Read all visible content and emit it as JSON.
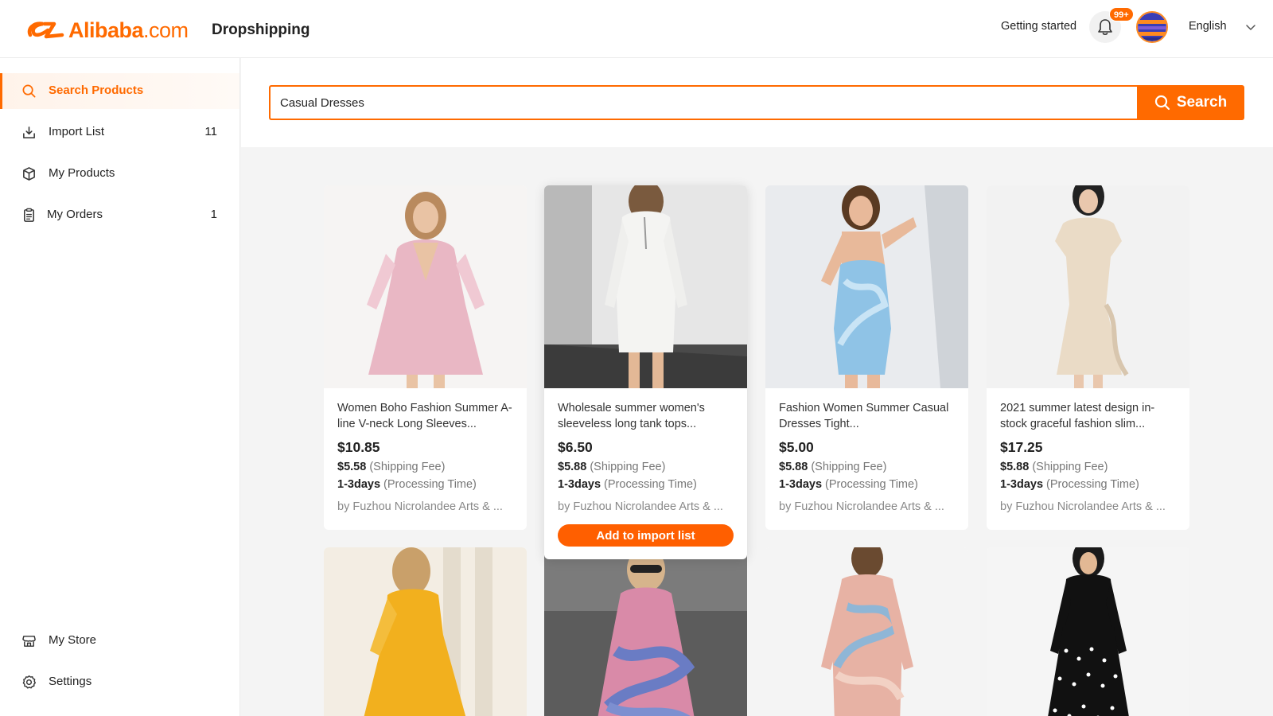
{
  "header": {
    "brand": "Alibaba",
    "brand_suffix": ".com",
    "app_name": "Dropshipping",
    "getting_started": "Getting started",
    "notification_badge": "99+",
    "language": "English"
  },
  "sidebar": {
    "items": [
      {
        "label": "Search Products",
        "count": "",
        "icon": "search-icon",
        "active": true
      },
      {
        "label": "Import List",
        "count": "11",
        "icon": "import-icon"
      },
      {
        "label": "My Products",
        "count": "",
        "icon": "box-icon"
      },
      {
        "label": "My Orders",
        "count": "1",
        "icon": "clipboard-icon"
      }
    ],
    "bottom_items": [
      {
        "label": "My Store",
        "icon": "store-icon"
      },
      {
        "label": "Settings",
        "icon": "gear-icon"
      }
    ]
  },
  "search": {
    "value": "Casual Dresses",
    "button_label": "Search"
  },
  "products": [
    {
      "title": "Women Boho Fashion Summer A-line V-neck Long Sleeves...",
      "price": "$10.85",
      "shipping": "$5.58",
      "shipping_label": "(Shipping Fee)",
      "processing": "1-3days",
      "processing_label": "(Processing Time)",
      "supplier": "by Fuzhou Nicrolandee Arts & ..."
    },
    {
      "title": "Wholesale summer women's sleeveless long tank tops...",
      "price": "$6.50",
      "shipping": "$5.88",
      "shipping_label": "(Shipping Fee)",
      "processing": "1-3days",
      "processing_label": "(Processing Time)",
      "supplier": "by Fuzhou Nicrolandee Arts & ...",
      "action": "Add to import list"
    },
    {
      "title": "Fashion Women Summer Casual Dresses Tight...",
      "price": "$5.00",
      "shipping": "$5.88",
      "shipping_label": "(Shipping Fee)",
      "processing": "1-3days",
      "processing_label": "(Processing Time)",
      "supplier": "by Fuzhou Nicrolandee Arts & ..."
    },
    {
      "title": "2021 summer latest design in-stock graceful fashion slim...",
      "price": "$17.25",
      "shipping": "$5.88",
      "shipping_label": "(Shipping Fee)",
      "processing": "1-3days",
      "processing_label": "(Processing Time)",
      "supplier": "by Fuzhou Nicrolandee Arts & ..."
    }
  ],
  "colors": {
    "accent": "#ff6a00",
    "dress_1": "#e9b7c4",
    "dress_2": "#f4f4f2",
    "dress_3": "#8fc3e6",
    "dress_4": "#eadbc6",
    "dress_5": "#f2b01e",
    "dress_6": "#d98aa8",
    "dress_7": "#e7b2a4",
    "dress_8": "#111111"
  }
}
